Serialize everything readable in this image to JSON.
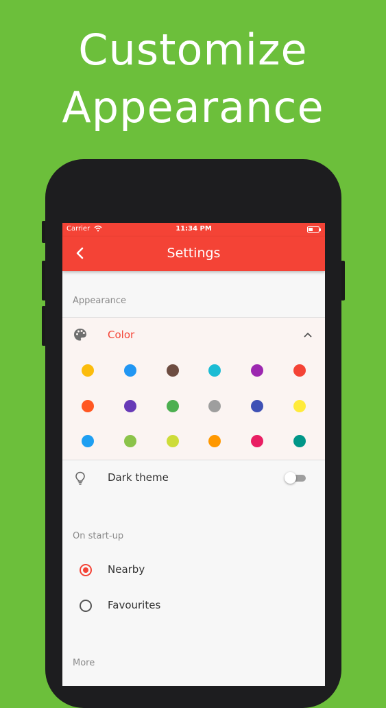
{
  "promo": {
    "line1": "Customize",
    "line2": "Appearance"
  },
  "status_bar": {
    "carrier": "Carrier",
    "time": "11:34 PM"
  },
  "app_bar": {
    "title": "Settings"
  },
  "appearance": {
    "header": "Appearance",
    "color_label": "Color",
    "dark_theme_label": "Dark theme",
    "dark_theme_on": false
  },
  "colors": {
    "accent": "#f44336",
    "background": "#6cbf3b",
    "swatches": [
      "#fbbc0d",
      "#2196f3",
      "#6d4c41",
      "#1cbcd4",
      "#9c27b0",
      "#f44336",
      "#ff5722",
      "#673ab7",
      "#4caf50",
      "#9e9e9e",
      "#3f51b5",
      "#ffeb3b",
      "#1e9ff2",
      "#8bc34a",
      "#cddc39",
      "#ff9800",
      "#e91e63",
      "#009688"
    ]
  },
  "startup": {
    "header": "On start-up",
    "options": [
      {
        "label": "Nearby",
        "selected": true
      },
      {
        "label": "Favourites",
        "selected": false
      }
    ]
  },
  "more": {
    "header": "More"
  }
}
